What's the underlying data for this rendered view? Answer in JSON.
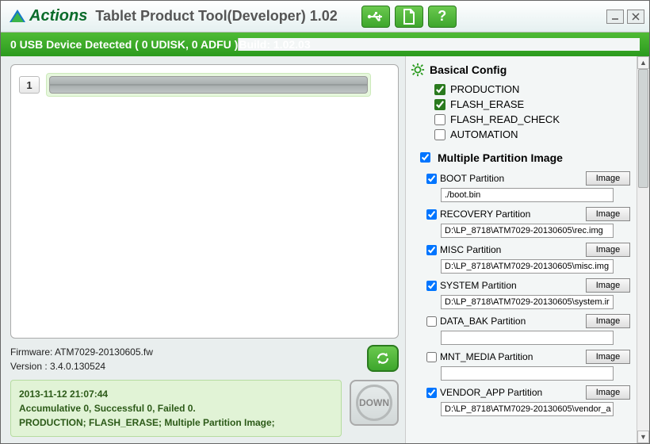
{
  "app": {
    "brand": "Actions",
    "title": "Tablet Product Tool(Developer) 1.02"
  },
  "status": {
    "left": "0 USB Device Detected ( 0 UDISK, 0 ADFU )",
    "right": "Build: 1.02.03"
  },
  "device": {
    "index": "1"
  },
  "firmware": {
    "line1": "Firmware: ATM7029-20130605.fw",
    "line2": "Version : 3.4.0.130524"
  },
  "summary": {
    "line1": "2013-11-12 21:07:44",
    "line2": "Accumulative 0, Successful 0, Failed 0.",
    "line3": "PRODUCTION; FLASH_ERASE; Multiple Partition Image;"
  },
  "down_label": "DOWN",
  "config": {
    "head": "Basical Config",
    "items": [
      {
        "label": "PRODUCTION",
        "checked": true
      },
      {
        "label": "FLASH_ERASE",
        "checked": true
      },
      {
        "label": "FLASH_READ_CHECK",
        "checked": false
      },
      {
        "label": "AUTOMATION",
        "checked": false
      }
    ],
    "multi_label": "Multiple Partition Image",
    "multi_checked": true,
    "partitions": [
      {
        "name": "BOOT Partition",
        "checked": true,
        "btn": "Image",
        "path": "./boot.bin"
      },
      {
        "name": "RECOVERY Partition",
        "checked": true,
        "btn": "Image",
        "path": "D:\\LP_8718\\ATM7029-20130605\\rec.img"
      },
      {
        "name": "MISC Partition",
        "checked": true,
        "btn": "Image",
        "path": "D:\\LP_8718\\ATM7029-20130605\\misc.img"
      },
      {
        "name": "SYSTEM Partition",
        "checked": true,
        "btn": "Image",
        "path": "D:\\LP_8718\\ATM7029-20130605\\system.ir"
      },
      {
        "name": "DATA_BAK Partition",
        "checked": false,
        "btn": "Image",
        "path": ""
      },
      {
        "name": "MNT_MEDIA Partition",
        "checked": false,
        "btn": "Image",
        "path": ""
      },
      {
        "name": "VENDOR_APP Partition",
        "checked": true,
        "btn": "Image",
        "path": "D:\\LP_8718\\ATM7029-20130605\\vendor_a"
      }
    ]
  }
}
